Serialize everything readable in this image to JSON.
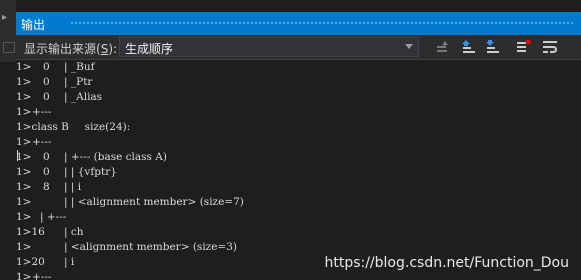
{
  "panel": {
    "title": "输出",
    "source_label": "显示输出来源(",
    "source_hotkey": "S",
    "source_label_end": "):",
    "source_value": "生成顺序"
  },
  "toolbar_icons": [
    "go-to-previous-message-icon",
    "go-to-next-message-icon",
    "find-message-icon",
    "clear-all-icon",
    "toggle-word-wrap-icon"
  ],
  "lines": [
    {
      "p": "1>",
      "o": "0",
      "t": "| _Buf"
    },
    {
      "p": "1>",
      "o": "0",
      "t": "| _Ptr"
    },
    {
      "p": "1>",
      "o": "0",
      "t": "| _Alias"
    },
    {
      "p": "1>",
      "o": "",
      "t": "+---"
    },
    {
      "p": "1>class B",
      "o": "",
      "t": "  size(24):"
    },
    {
      "p": "1>",
      "o": "",
      "t": "+---"
    },
    {
      "p": "1>",
      "o": "0",
      "t": "| +--- (base class A)"
    },
    {
      "p": "1>",
      "o": "0",
      "t": "| | {vfptr}"
    },
    {
      "p": "1>",
      "o": "8",
      "t": "| | i"
    },
    {
      "p": "1>",
      "o": "",
      "t": "| | <alignment member> (size=7)"
    },
    {
      "p": "1>",
      "o": "",
      "t": "| +---"
    },
    {
      "p": "1>16",
      "o": "",
      "t": "| ch"
    },
    {
      "p": "1>",
      "o": "",
      "t": "| <alignment member> (size=3)"
    },
    {
      "p": "1>20",
      "o": "",
      "t": "| i"
    },
    {
      "p": "1>",
      "o": "",
      "t": "+---"
    }
  ],
  "watermark": "https://blog.csdn.net/Function_Dou",
  "colors": {
    "accent": "#007acc",
    "background": "#1e1e1e",
    "text": "#dcdcdc"
  }
}
